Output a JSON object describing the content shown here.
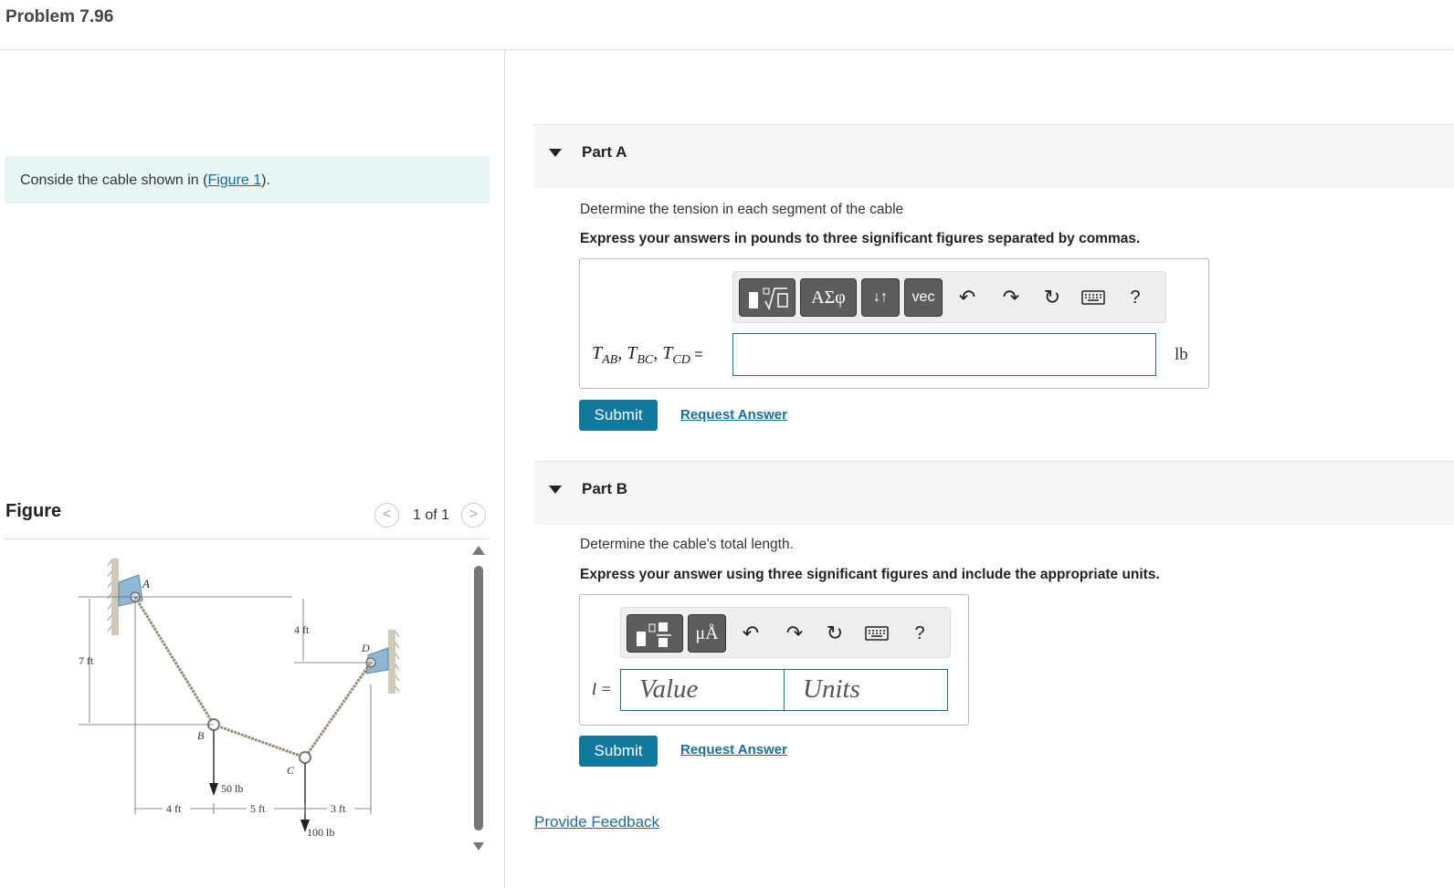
{
  "header": {
    "title": "Problem 7.96"
  },
  "intro": {
    "text_before": "Conside the cable shown in (",
    "link": "Figure 1",
    "text_after": ")."
  },
  "figure": {
    "heading": "Figure",
    "counter": "1 of 1",
    "prev_icon": "chevron-left-icon",
    "next_icon": "chevron-right-icon",
    "labels": {
      "A": "A",
      "B": "B",
      "C": "C",
      "D": "D",
      "height_7ft": "7 ft",
      "height_4ft": "4 ft",
      "load_B": "50 lb",
      "load_C": "100 lb",
      "span_1": "4 ft",
      "span_2": "5 ft",
      "span_3": "3 ft"
    }
  },
  "partA": {
    "label": "Part A",
    "question": "Determine the tension in each segment of the cable",
    "instruction": "Express your answers in pounds to three significant figures separated by commas.",
    "toolbar": {
      "templates_icon": "templates-icon",
      "greek_label": "ΑΣφ",
      "updown_label": "↓↑",
      "vec_label": "vec",
      "undo_icon": "undo-icon",
      "redo_icon": "redo-icon",
      "reset_icon": "reset-icon",
      "keyboard_icon": "keyboard-icon",
      "help_label": "?"
    },
    "answer_label": {
      "t1": "T",
      "s1": "AB",
      "t2": "T",
      "s2": "BC",
      "t3": "T",
      "s3": "CD",
      "eq": " ="
    },
    "answer_value": "",
    "unit": "lb",
    "submit": "Submit",
    "request": "Request Answer"
  },
  "partB": {
    "label": "Part B",
    "question": "Determine the cable's total length.",
    "instruction": "Express your answer using three significant figures and include the appropriate units.",
    "toolbar": {
      "templates_icon": "templates-icon",
      "units_label": "μÅ",
      "undo_icon": "undo-icon",
      "redo_icon": "redo-icon",
      "reset_icon": "reset-icon",
      "keyboard_icon": "keyboard-icon",
      "help_label": "?"
    },
    "answer_label": "l =",
    "value_placeholder": "Value",
    "units_placeholder": "Units",
    "submit": "Submit",
    "request": "Request Answer"
  },
  "feedback": "Provide Feedback",
  "colors": {
    "accent": "#0f7a9e",
    "link": "#1b6f95",
    "intro_bg": "#e8f5f5",
    "cable": "#9a8b78",
    "support": "#8fb7d3"
  }
}
